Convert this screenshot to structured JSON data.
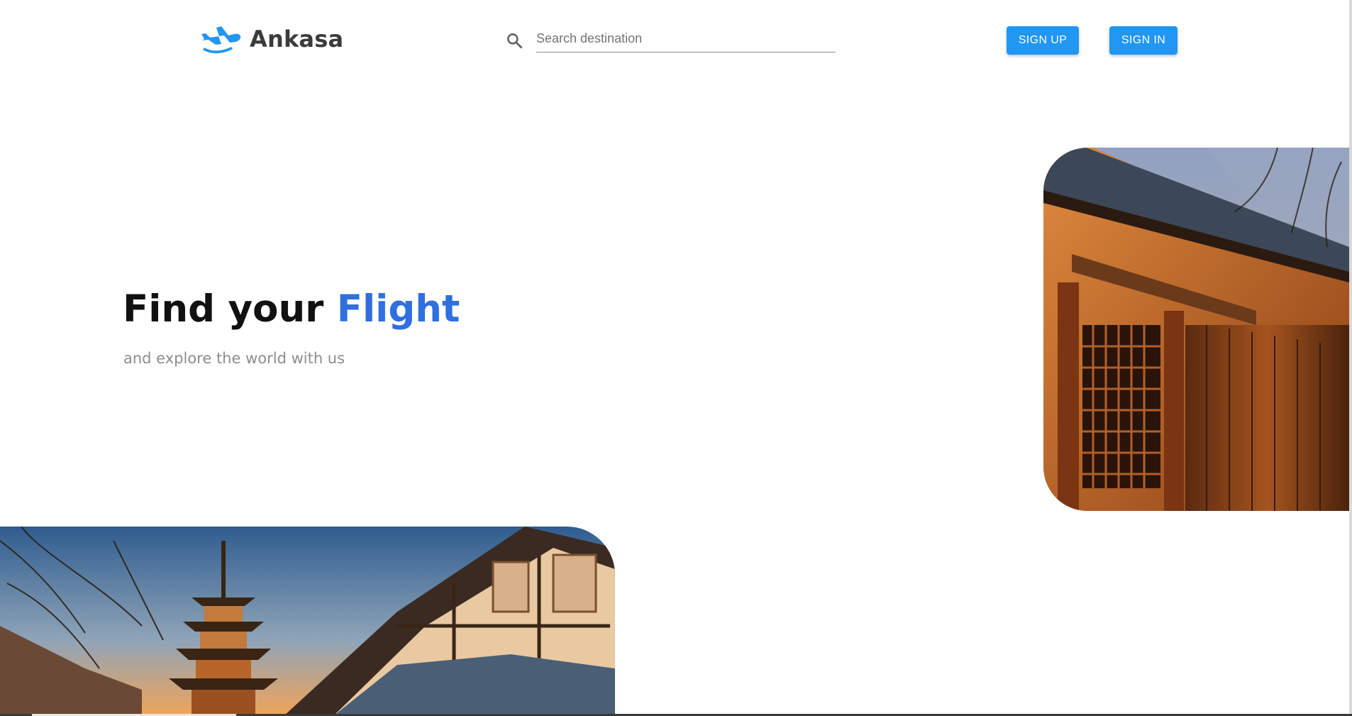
{
  "header": {
    "brand_name": "Ankasa",
    "logo_icon": "airplane-icon",
    "search": {
      "icon": "search-icon",
      "placeholder": "Search destination",
      "value": ""
    },
    "sign_up_label": "SIGN UP",
    "sign_in_label": "SIGN IN"
  },
  "hero": {
    "title_prefix": "Find your ",
    "title_accent": "Flight",
    "subtitle": "and explore the world with us"
  },
  "images": {
    "right": "wooden-house-street-photo",
    "left": "pagoda-street-photo"
  },
  "colors": {
    "accent": "#2f6fe0",
    "button": "#2196f3",
    "logo": "#2196f3",
    "brand_text": "#3b3b3b",
    "subtitle": "#8d8d8d"
  }
}
